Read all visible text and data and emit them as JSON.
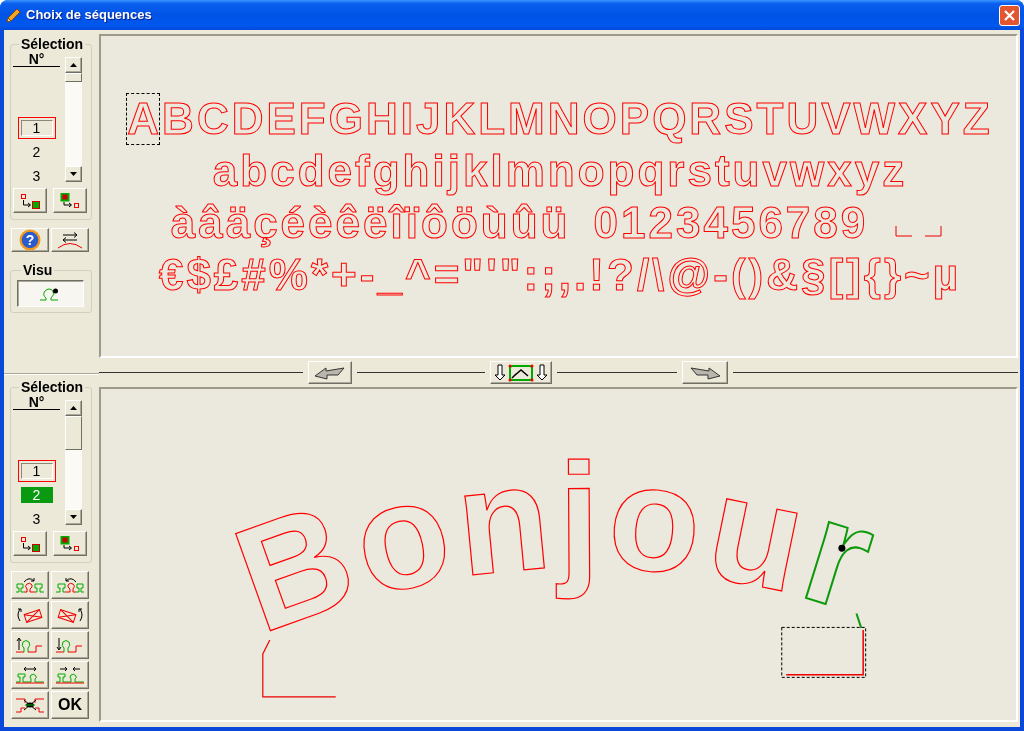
{
  "window": {
    "title": "Choix de séquences"
  },
  "top_panel": {
    "selection": {
      "title": "Sélection",
      "header": "N°",
      "items": [
        {
          "label": "1",
          "focused": true,
          "selected": false
        },
        {
          "label": "2",
          "focused": false,
          "selected": false
        },
        {
          "label": "3",
          "focused": false,
          "selected": false
        }
      ]
    },
    "help_button": {
      "label": "?"
    },
    "visu": {
      "title": "Visu",
      "pressed": true
    },
    "glyph_rows": [
      {
        "groups": [
          {
            "kind": "text",
            "glyphs": [
              {
                "char": "A",
                "selected": true
              },
              {
                "char": "B",
                "selected": false
              },
              {
                "char": "C",
                "selected": false
              },
              {
                "char": "D",
                "selected": false
              },
              {
                "char": "E",
                "selected": false
              },
              {
                "char": "F",
                "selected": false
              },
              {
                "char": "G",
                "selected": false
              },
              {
                "char": "H",
                "selected": false
              },
              {
                "char": "I",
                "selected": false
              },
              {
                "char": "J",
                "selected": false
              },
              {
                "char": "K",
                "selected": false
              },
              {
                "char": "L",
                "selected": false
              },
              {
                "char": "M",
                "selected": false
              },
              {
                "char": "N",
                "selected": false
              },
              {
                "char": "O",
                "selected": false
              },
              {
                "char": "P",
                "selected": false
              },
              {
                "char": "Q",
                "selected": false
              },
              {
                "char": "R",
                "selected": false
              },
              {
                "char": "S",
                "selected": false
              },
              {
                "char": "T",
                "selected": false
              },
              {
                "char": "U",
                "selected": false
              },
              {
                "char": "V",
                "selected": false
              },
              {
                "char": "W",
                "selected": false
              },
              {
                "char": "X",
                "selected": false
              },
              {
                "char": "Y",
                "selected": false
              },
              {
                "char": "Z",
                "selected": false
              }
            ]
          }
        ]
      },
      {
        "groups": [
          {
            "kind": "text",
            "glyphs": [
              {
                "char": "a",
                "selected": false
              },
              {
                "char": "b",
                "selected": false
              },
              {
                "char": "c",
                "selected": false
              },
              {
                "char": "d",
                "selected": false
              },
              {
                "char": "e",
                "selected": false
              },
              {
                "char": "f",
                "selected": false
              },
              {
                "char": "g",
                "selected": false
              },
              {
                "char": "h",
                "selected": false
              },
              {
                "char": "i",
                "selected": false
              },
              {
                "char": "j",
                "selected": false
              },
              {
                "char": "k",
                "selected": false
              },
              {
                "char": "l",
                "selected": false
              },
              {
                "char": "m",
                "selected": false
              },
              {
                "char": "n",
                "selected": false
              },
              {
                "char": "o",
                "selected": false
              },
              {
                "char": "p",
                "selected": false
              },
              {
                "char": "q",
                "selected": false
              },
              {
                "char": "r",
                "selected": false
              },
              {
                "char": "s",
                "selected": false
              },
              {
                "char": "t",
                "selected": false
              },
              {
                "char": "u",
                "selected": false
              },
              {
                "char": "v",
                "selected": false
              },
              {
                "char": "w",
                "selected": false
              },
              {
                "char": "x",
                "selected": false
              },
              {
                "char": "y",
                "selected": false
              },
              {
                "char": "z",
                "selected": false
              }
            ]
          }
        ]
      },
      {
        "groups": [
          {
            "kind": "text",
            "glyphs": [
              {
                "char": "à",
                "selected": false
              },
              {
                "char": "â",
                "selected": false
              },
              {
                "char": "ä",
                "selected": false
              },
              {
                "char": "ç",
                "selected": false
              },
              {
                "char": "é",
                "selected": false
              },
              {
                "char": "è",
                "selected": false
              },
              {
                "char": "ê",
                "selected": false
              },
              {
                "char": "ë",
                "selected": false
              },
              {
                "char": "î",
                "selected": false
              },
              {
                "char": "ï",
                "selected": false
              },
              {
                "char": "ô",
                "selected": false
              },
              {
                "char": "ö",
                "selected": false
              },
              {
                "char": "ù",
                "selected": false
              },
              {
                "char": "û",
                "selected": false
              },
              {
                "char": "ü",
                "selected": false
              }
            ]
          },
          {
            "kind": "text",
            "glyphs": [
              {
                "char": "0",
                "selected": false
              },
              {
                "char": "1",
                "selected": false
              },
              {
                "char": "2",
                "selected": false
              },
              {
                "char": "3",
                "selected": false
              },
              {
                "char": "4",
                "selected": false
              },
              {
                "char": "5",
                "selected": false
              },
              {
                "char": "6",
                "selected": false
              },
              {
                "char": "7",
                "selected": false
              },
              {
                "char": "8",
                "selected": false
              },
              {
                "char": "9",
                "selected": false
              }
            ]
          },
          {
            "kind": "space",
            "glyphs": [
              {
                "selected": false
              },
              {
                "selected": false
              }
            ]
          }
        ]
      },
      {
        "groups": [
          {
            "kind": "text",
            "glyphs": [
              {
                "char": "€",
                "selected": false
              },
              {
                "char": "$",
                "selected": false
              },
              {
                "char": "£",
                "selected": false
              },
              {
                "char": "#",
                "selected": false
              },
              {
                "char": "%",
                "selected": false
              },
              {
                "char": "*",
                "selected": false
              },
              {
                "char": "+",
                "selected": false
              },
              {
                "char": "-",
                "selected": false
              },
              {
                "char": "_",
                "selected": false
              },
              {
                "char": "^",
                "selected": false
              },
              {
                "char": "=",
                "selected": false
              },
              {
                "char": "\"",
                "selected": false
              },
              {
                "char": "'",
                "selected": false
              },
              {
                "char": "\"",
                "selected": false
              },
              {
                "char": ":",
                "selected": false
              },
              {
                "char": ";",
                "selected": false
              },
              {
                "char": ",",
                "selected": false
              },
              {
                "char": ".",
                "selected": false
              },
              {
                "char": "!",
                "selected": false
              },
              {
                "char": "?",
                "selected": false
              },
              {
                "char": "/",
                "selected": false
              },
              {
                "char": "\\",
                "selected": false
              },
              {
                "char": "@",
                "selected": false
              },
              {
                "char": "-",
                "selected": false
              },
              {
                "char": "(",
                "selected": false
              },
              {
                "char": ")",
                "selected": false
              },
              {
                "char": "&",
                "selected": false
              },
              {
                "char": "§",
                "selected": false
              },
              {
                "char": "[",
                "selected": false
              },
              {
                "char": "]",
                "selected": false
              },
              {
                "char": "{",
                "selected": false
              },
              {
                "char": "}",
                "selected": false
              },
              {
                "char": "~",
                "selected": false
              },
              {
                "char": "µ",
                "selected": false
              }
            ]
          }
        ]
      }
    ]
  },
  "bottom_panel": {
    "selection": {
      "title": "Sélection",
      "header": "N°",
      "items": [
        {
          "label": "1",
          "focused": true,
          "selected": false
        },
        {
          "label": "2",
          "focused": false,
          "selected": true
        },
        {
          "label": "3",
          "focused": false,
          "selected": false
        }
      ]
    },
    "ok_button": {
      "label": "OK"
    },
    "curved_text": [
      {
        "text": "Bonjou",
        "selected": false
      },
      {
        "text": "r",
        "selected": true
      }
    ]
  }
}
